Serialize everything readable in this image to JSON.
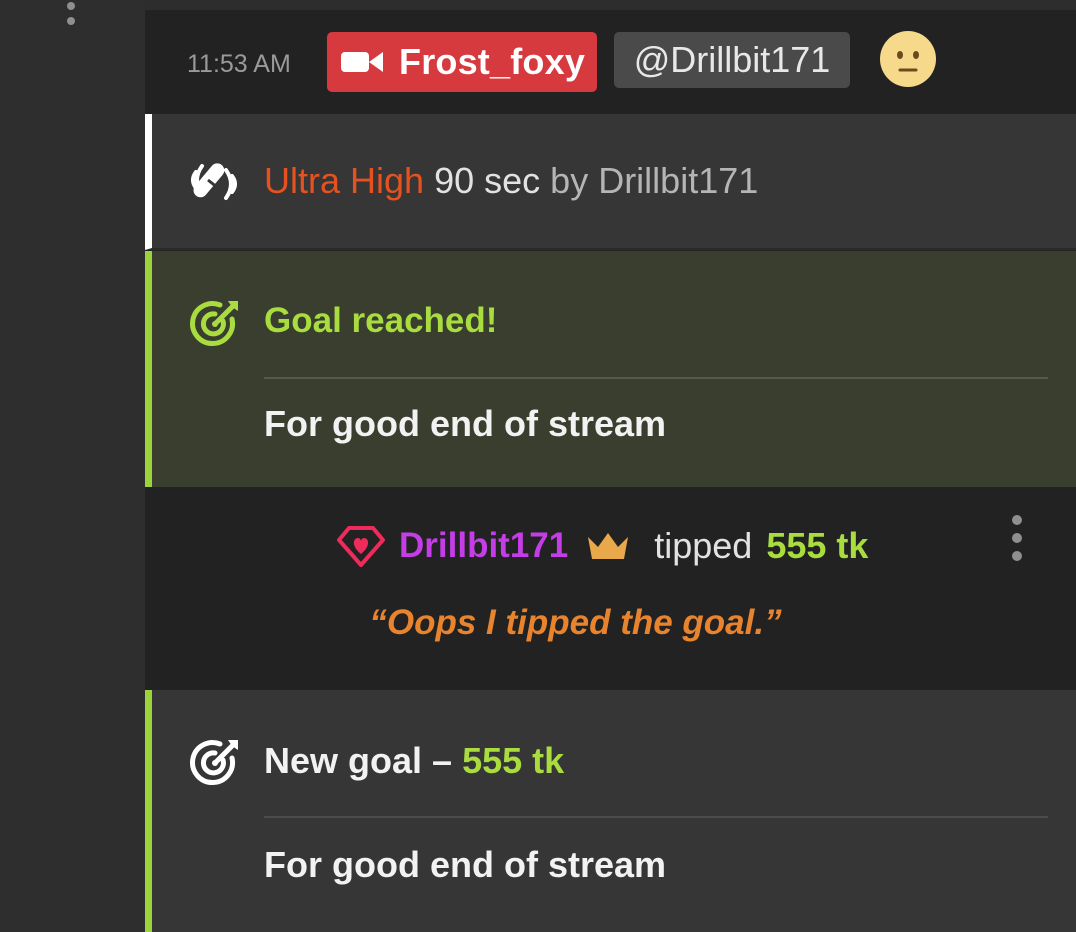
{
  "header": {
    "timestamp": "11:53 AM",
    "host_name": "Frost_foxy",
    "mention": "@Drillbit171",
    "emoji_icon": "neutral-face-emoji"
  },
  "vibe": {
    "icon": "vibration-icon",
    "level": "Ultra High",
    "duration": "90 sec",
    "by": "by Drillbit171"
  },
  "goal_reached": {
    "icon": "target-icon",
    "title": "Goal reached!",
    "description": "For good end of stream"
  },
  "tip": {
    "badge_icon": "diamond-heart-icon",
    "user": "Drillbit171",
    "crown_icon": "crown-icon",
    "verb": "tipped",
    "amount": "555 tk",
    "message": "“Oops I tipped the goal.”"
  },
  "new_goal": {
    "icon": "target-icon",
    "label": "New goal – ",
    "amount": "555 tk",
    "description": "For good end of stream"
  },
  "colors": {
    "accent_green": "#a8dc3f",
    "host_red": "#d63a3f",
    "level_orange": "#e6521f",
    "user_purple": "#c43de6",
    "message_orange": "#e8832e"
  }
}
